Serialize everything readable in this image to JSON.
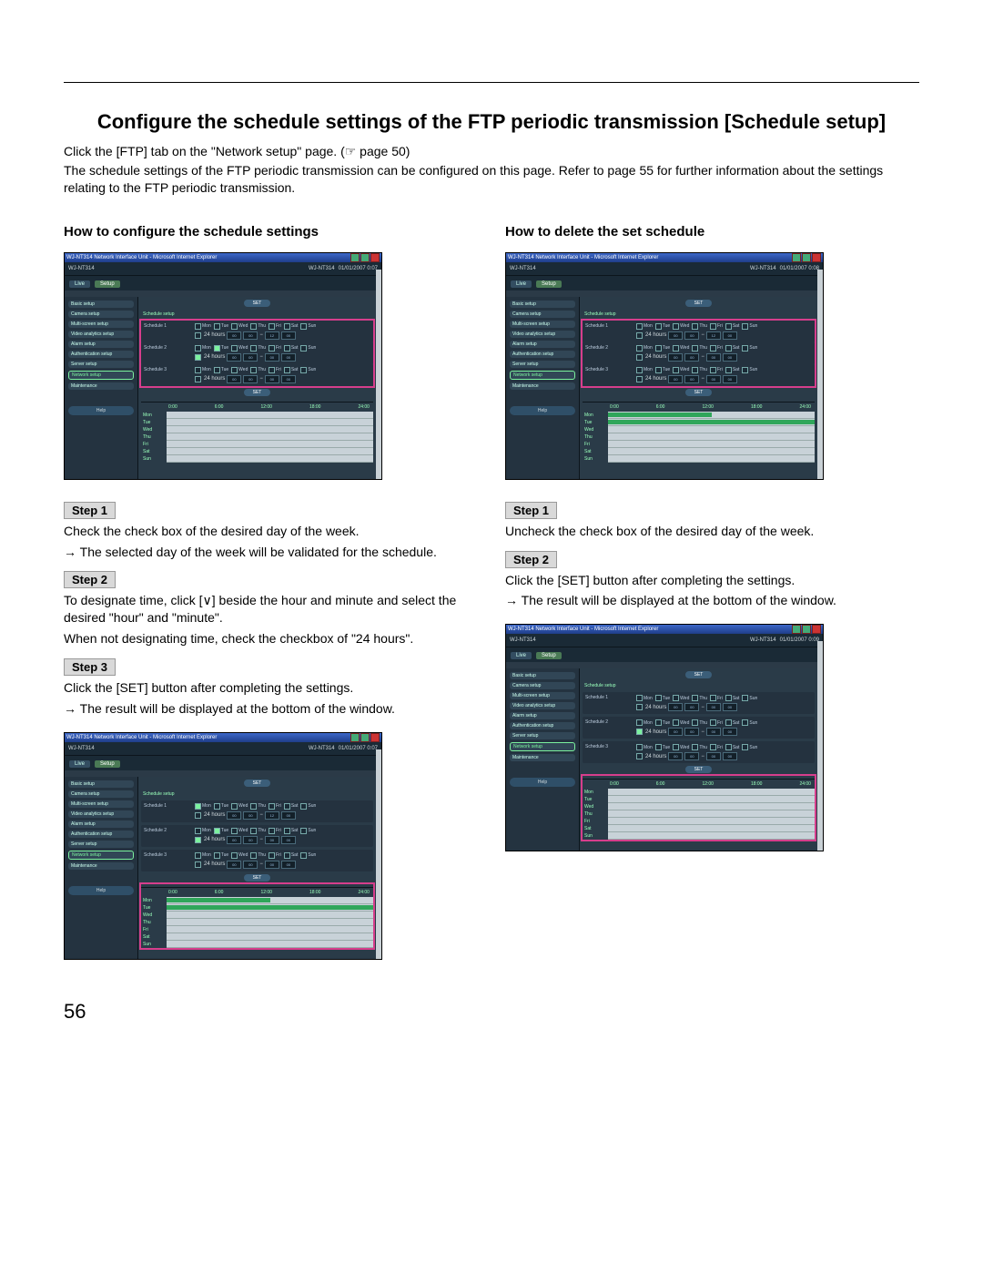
{
  "page_number": "56",
  "heading": "Configure the schedule settings of the FTP periodic transmission [Schedule setup]",
  "intro1": "Click the [FTP] tab on the \"Network setup\" page. (☞ page 50)",
  "intro2": "The schedule settings of the FTP periodic transmission can be configured on this page. Refer to page 55 for further information about the settings relating to the FTP periodic transmission.",
  "left": {
    "heading": "How to configure the schedule settings",
    "step1_label": "Step 1",
    "step1_a": "Check the check box of the desired day of the week.",
    "step1_b": "→ The selected day of the week will be validated for the schedule.",
    "step2_label": "Step 2",
    "step2_a": "To designate time, click [∨] beside the hour and minute and select the desired \"hour\" and \"minute\".",
    "step2_b": "When not designating time, check the checkbox of \"24 hours\".",
    "step3_label": "Step 3",
    "step3_a": "Click the [SET] button after completing the settings.",
    "step3_b": "→ The result will be displayed at the bottom of the window."
  },
  "right": {
    "heading": "How to delete the set schedule",
    "step1_label": "Step 1",
    "step1_a": "Uncheck the check box of the desired day of the week.",
    "step2_label": "Step 2",
    "step2_a": "Click the [SET] button after completing the settings.",
    "step2_b": "→ The result will be displayed at the bottom of the window."
  },
  "app": {
    "window_title": "WJ-NT314 Network Interface Unit - Microsoft Internet Explorer",
    "brand": "WJ-NT314",
    "model": "WJ-NT314",
    "timestamp": "01/01/2007 0:07",
    "timestamp_b": "01/01/2007 0:08",
    "timestamp_c": "01/01/2007 0:09",
    "live": "Live",
    "setup": "Setup",
    "set": "SET",
    "help": "Help",
    "nav": {
      "basic": "Basic setup",
      "camera": "Camera setup",
      "multi": "Multi-screen setup",
      "video": "Video analytics setup",
      "alarm": "Alarm setup",
      "auth": "Authentication setup",
      "server": "Server setup",
      "network": "Network setup",
      "maint": "Maintenance"
    },
    "section": "Schedule setup",
    "schedule1": "Schedule 1",
    "schedule2": "Schedule 2",
    "schedule3": "Schedule 3",
    "days": [
      "Mon",
      "Tue",
      "Wed",
      "Thu",
      "Fri",
      "Sat",
      "Sun"
    ],
    "hours_lbl": "24 hours",
    "sel": [
      "00",
      "00",
      "−",
      "12",
      "00"
    ],
    "sel_alt": [
      "00",
      "00",
      "−",
      "00",
      "00"
    ],
    "timeline": [
      "0:00",
      "6:00",
      "12:00",
      "18:00",
      "24:00"
    ],
    "daylist": [
      "Mon",
      "Tue",
      "Wed",
      "Thu",
      "Fri",
      "Sat",
      "Sun"
    ]
  }
}
